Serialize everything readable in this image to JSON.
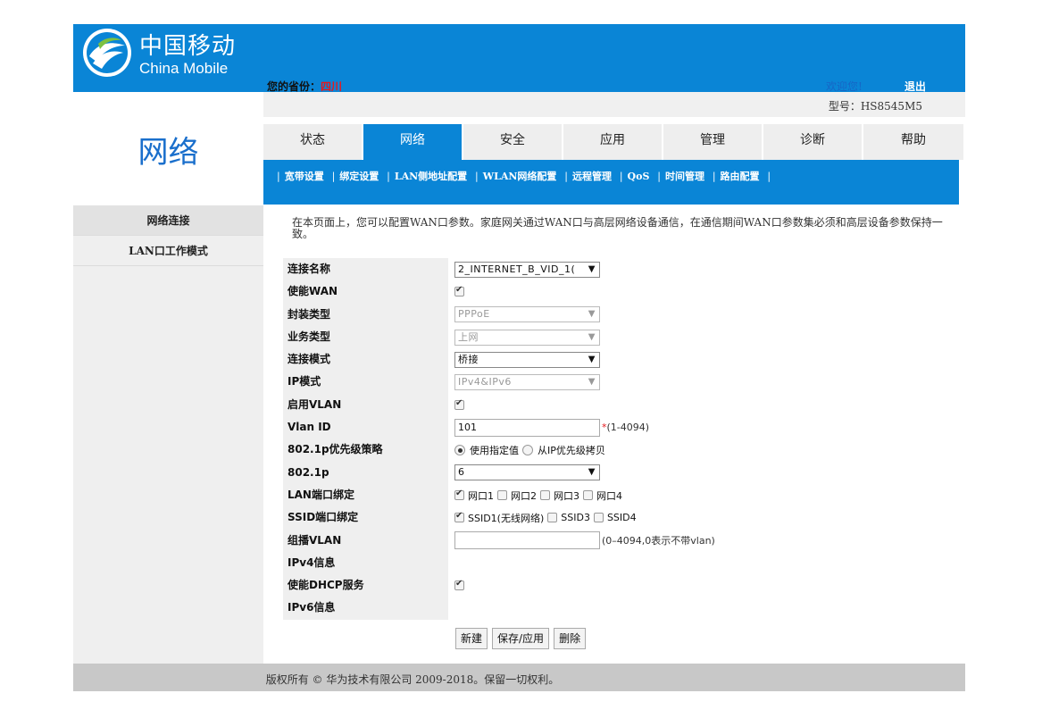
{
  "header": {
    "logo_cn": "中国移动",
    "logo_en": "China Mobile",
    "province_label": "您的省份：",
    "province_value": "四川",
    "welcome": "欢迎您!",
    "logout": "退出",
    "brand_color": "#0a85d6"
  },
  "model": "型号：HS8545M5",
  "section_title": "网络",
  "left_menu": [
    {
      "label": "网络连接"
    },
    {
      "label": "LAN口工作模式"
    }
  ],
  "tabs": [
    {
      "label": "状态"
    },
    {
      "label": "网络"
    },
    {
      "label": "安全"
    },
    {
      "label": "应用"
    },
    {
      "label": "管理"
    },
    {
      "label": "诊断"
    },
    {
      "label": "帮助"
    }
  ],
  "subnav": [
    {
      "label": "宽带设置"
    },
    {
      "label": "绑定设置"
    },
    {
      "label": "LAN侧地址配置"
    },
    {
      "label": "WLAN网络配置"
    },
    {
      "label": "远程管理"
    },
    {
      "label": "QoS"
    },
    {
      "label": "时间管理"
    },
    {
      "label": "路由配置"
    }
  ],
  "description": "在本页面上，您可以配置WAN口参数。家庭网关通过WAN口与高层网络设备通信，在通信期间WAN口参数集必须和高层设备参数保持一致。",
  "form": {
    "connection_name": {
      "label": "连接名称",
      "value": "2_INTERNET_B_VID_1("
    },
    "enable_wan": {
      "label": "使能WAN",
      "checked": true
    },
    "encap_type": {
      "label": "封装类型",
      "value": "PPPoE"
    },
    "service_type": {
      "label": "业务类型",
      "value": "上网"
    },
    "conn_mode": {
      "label": "连接模式",
      "value": "桥接"
    },
    "ip_mode": {
      "label": "IP模式",
      "value": "IPv4&IPv6"
    },
    "enable_vlan": {
      "label": "启用VLAN",
      "checked": true
    },
    "vlan_id": {
      "label": "Vlan ID",
      "value": "101",
      "star": "*",
      "hint": "(1-4094)"
    },
    "priority_policy": {
      "label": "802.1p优先级策略",
      "opt1": "使用指定值",
      "opt2": "从IP优先级拷贝"
    },
    "p8021": {
      "label": "802.1p",
      "value": "6"
    },
    "lan_bind": {
      "label": "LAN端口绑定",
      "ports": [
        "网口1",
        "网口2",
        "网口3",
        "网口4"
      ]
    },
    "ssid_bind": {
      "label": "SSID端口绑定",
      "ssids": [
        "SSID1(无线网络)",
        "SSID3",
        "SSID4"
      ]
    },
    "mcast_vlan": {
      "label": "组播VLAN",
      "value": "",
      "hint": "(0–4094,0表示不带vlan)"
    },
    "ipv4_info": {
      "label": "IPv4信息"
    },
    "enable_dhcp": {
      "label": "使能DHCP服务",
      "checked": true
    },
    "ipv6_info": {
      "label": "IPv6信息"
    }
  },
  "buttons": {
    "new": "新建",
    "save": "保存/应用",
    "delete": "删除"
  },
  "footer": "版权所有 © 华为技术有限公司 2009-2018。保留一切权利。"
}
